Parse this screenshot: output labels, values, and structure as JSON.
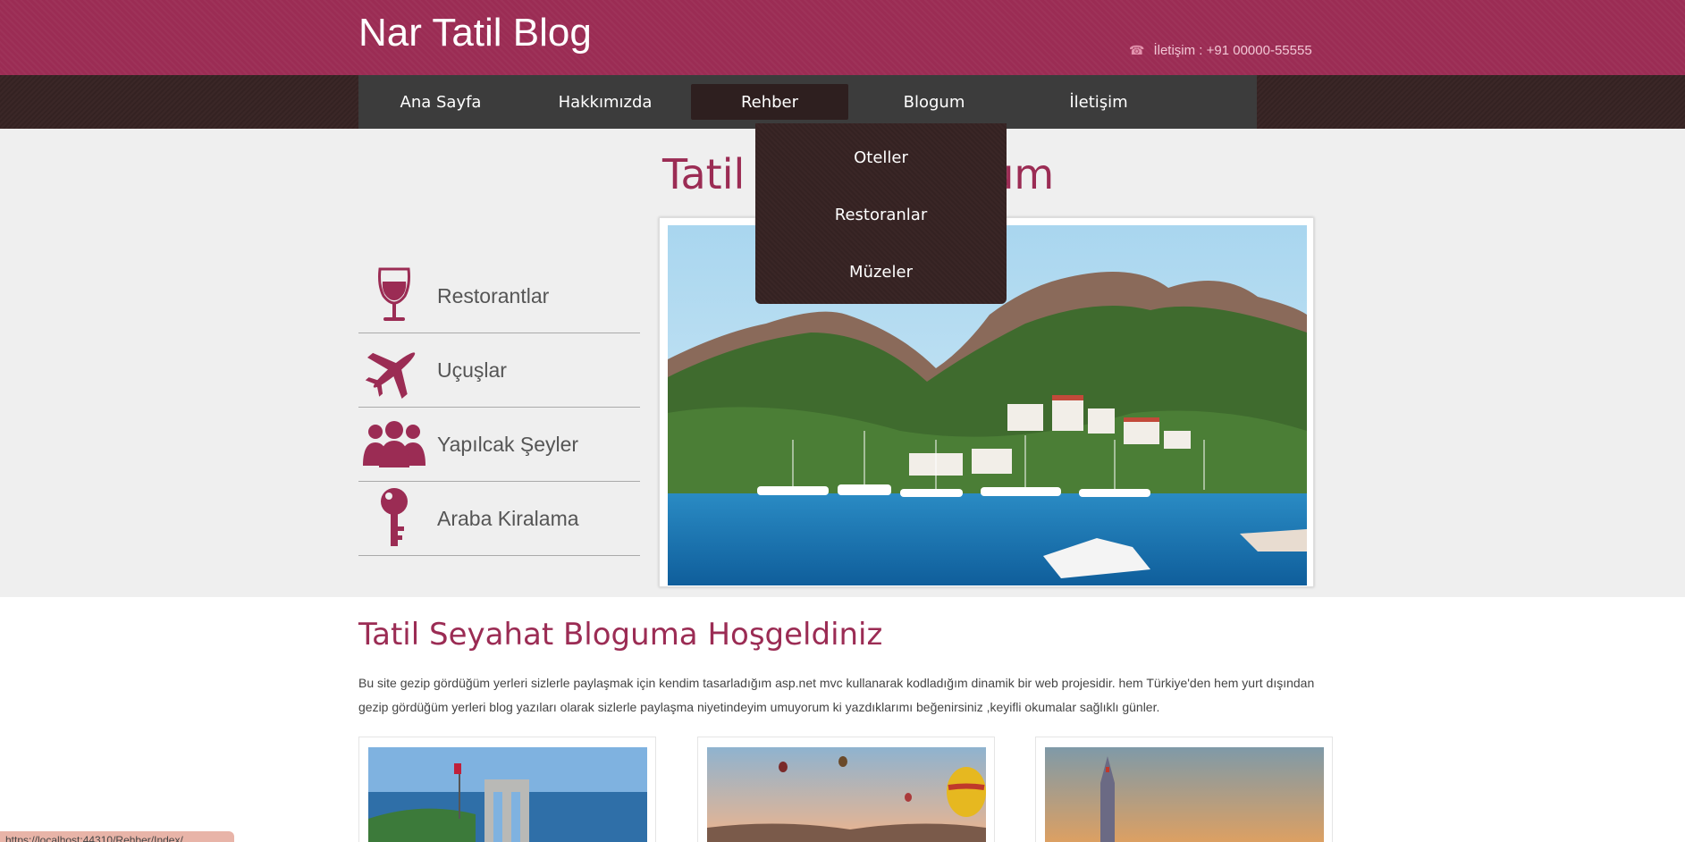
{
  "header": {
    "brand": "Nar Tatil Blog",
    "contact_label": "İletişim : +91 00000-55555",
    "phone_icon": "phone-icon"
  },
  "nav": {
    "items": [
      {
        "label": "Ana Sayfa"
      },
      {
        "label": "Hakkımızda"
      },
      {
        "label": "Rehber"
      },
      {
        "label": "Blogum"
      },
      {
        "label": "İletişim"
      }
    ],
    "active_index": 2
  },
  "dropdown": {
    "items": [
      {
        "label": "Oteller"
      },
      {
        "label": "Restoranlar"
      },
      {
        "label": "Müzeler"
      }
    ]
  },
  "hero": {
    "title": "Tatil ... oğum",
    "sidebar": [
      {
        "label": "Restorantlar",
        "icon": "wine-glass-icon"
      },
      {
        "label": "Uçuşlar",
        "icon": "airplane-icon"
      },
      {
        "label": "Yapılcak Şeyler",
        "icon": "people-icon"
      },
      {
        "label": "Araba Kiralama",
        "icon": "key-icon"
      }
    ]
  },
  "welcome": {
    "title": "Tatil Seyahat Bloguma Hoşgeldiniz",
    "text": "Bu site gezip gördüğüm yerleri sizlerle paylaşmak için kendim tasarladığım asp.net mvc kullanarak kodladığım dinamik bir web projesidir. hem Türkiye'den hem yurt dışından gezip gördüğüm yerleri blog yazıları olarak sizlerle paylaşma niyetindeyim umuyorum ki yazdıklarımı beğenirsiniz ,keyifli okumalar sağlıklı günler."
  },
  "status_bar": {
    "url": "https://localhost:44310/Rehber/Index/"
  },
  "colors": {
    "brand": "#9b2c54",
    "nav_bg": "#3c3c3c",
    "dropdown_bg": "#3a2626"
  }
}
